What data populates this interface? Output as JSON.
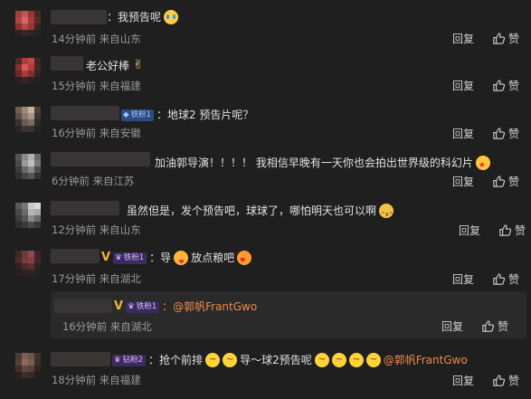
{
  "comments": [
    {
      "text": "：我预告呢",
      "time": "14分钟前",
      "location": "来自山东",
      "reply": "回复",
      "like": "赞",
      "emoji": "cry"
    },
    {
      "text": "老公好棒",
      "time": "15分钟前",
      "location": "来自福建",
      "reply": "回复",
      "like": "赞",
      "emoji": "hand"
    },
    {
      "badge": "铁粉1",
      "text": "：地球2 预告片呢？",
      "time": "16分钟前",
      "location": "来自安徽",
      "reply": "回复",
      "like": "赞"
    },
    {
      "text": "加油郭导演！！！！ 我相信早晚有一天你也会拍出世界级的科幻片",
      "time": "6分钟前",
      "location": "来自江苏",
      "reply": "回复",
      "like": "赞",
      "emoji": "star"
    },
    {
      "text": "虽然但是，发个预告吧，球球了，哪怕明天也可以啊",
      "time": "12分钟前",
      "location": "来自山东",
      "reply": "回复",
      "like": "赞",
      "emoji": "cat"
    },
    {
      "badge": "铁粉1",
      "text_a": "：导",
      "text_b": "放点粮吧",
      "time": "17分钟前",
      "location": "来自湖北",
      "reply": "回复",
      "like": "赞"
    },
    {
      "badge": "铁粉1",
      "mention": "：@郭帆FrantGwo",
      "time": "16分钟前",
      "location": "来自湖北",
      "reply": "回复",
      "like": "赞"
    },
    {
      "badge": "钻粉2",
      "text_a": "：抢个前排",
      "text_b": "导～球2预告呢",
      "mention": "@郭帆FrantGwo",
      "time": "18分钟前",
      "location": "来自福建",
      "reply": "回复",
      "like": "赞"
    }
  ],
  "icons": {
    "like": "thumb-up-icon",
    "vip": "v-icon",
    "crown": "crown-icon"
  },
  "colors": {
    "background": "#1f1f1f",
    "mention": "#f08a4a",
    "vip": "#f4b23c"
  }
}
